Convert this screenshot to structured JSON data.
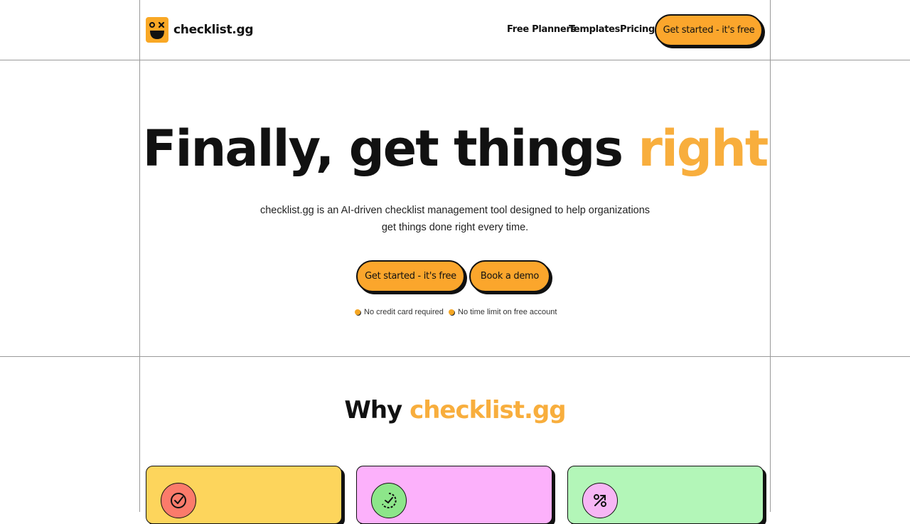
{
  "header": {
    "brand": "checklist.gg",
    "nav": [
      "Free Planners",
      "Templates",
      "Pricing"
    ],
    "cta": "Get started - it's free"
  },
  "hero": {
    "title_main": "Finally, get things ",
    "title_accent": "right",
    "subtitle_line1": "checklist.gg is an AI-driven checklist management tool designed to help organizations",
    "subtitle_line2": "get things done right every time.",
    "primary_button": "Get started - it's free",
    "secondary_button": "Book a demo",
    "perks": [
      "No credit card required",
      "No time limit on free account"
    ]
  },
  "why": {
    "title_main": "Why ",
    "title_accent": "checklist.gg"
  },
  "cards": [
    {
      "icon": "check-circle-icon",
      "color": "#fdd55c",
      "icon_bg": "#fb7b6b"
    },
    {
      "icon": "progress-check-icon",
      "color": "#fcb1fb",
      "icon_bg": "#8de68a"
    },
    {
      "icon": "percent-arrow-icon",
      "color": "#b3f6b8",
      "icon_bg": "#f7b6f5"
    }
  ],
  "colors": {
    "accent": "#f8ae3d",
    "button": "#fba62c"
  }
}
